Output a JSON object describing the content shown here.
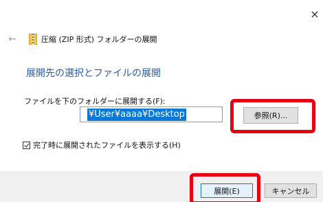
{
  "window": {
    "close_symbol": "×"
  },
  "header": {
    "back_symbol": "←",
    "title": "圧縮 (ZIP 形式) フォルダーの展開",
    "icon": "zip-folder-icon"
  },
  "main": {
    "heading": "展開先の選択とファイルの展開",
    "dest_label": "ファイルを下のフォルダーに展開する(F):",
    "path_value": "¥User¥aaaa¥Desktop",
    "browse_label": "参照(R)...",
    "checkbox_label": "完了時に展開されたファイルを表示する(H)",
    "checkbox_checked": true
  },
  "footer": {
    "extract_label": "展開(E)",
    "cancel_label": "キャンセル"
  },
  "colors": {
    "heading": "#2a5db0",
    "selection": "#0a78d7",
    "highlight_box": "#e60012"
  }
}
